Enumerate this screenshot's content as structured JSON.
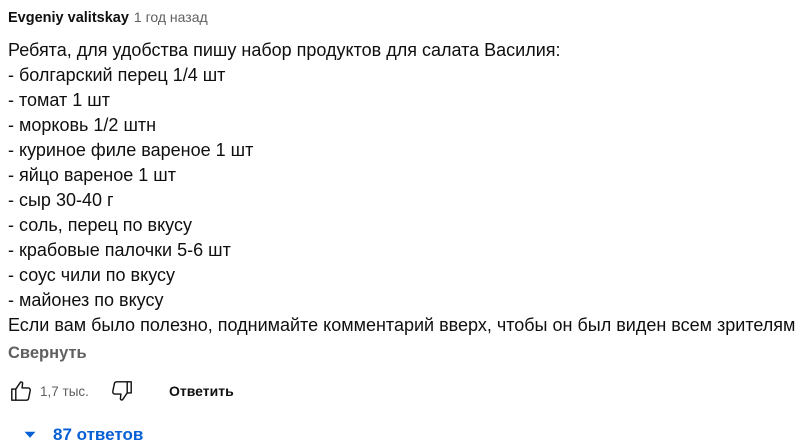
{
  "comment": {
    "author": "Evgeniy valitskay",
    "timestamp": "1 год назад",
    "lines": [
      "Ребята, для удобства пишу набор продуктов для салата Василия:",
      "- болгарский перец 1/4 шт",
      "- томат 1 шт",
      "- морковь 1/2 штн",
      "- куриное филе вареное 1 шт",
      "- яйцо вареное 1 шт",
      "- сыр 30-40 г",
      "- соль, перец по вкусу",
      "- крабовые палочки 5-6 шт",
      "- соус чили по вкусу",
      "- майонез по вкусу",
      "Если вам было полезно, поднимайте комментарий вверх, чтобы он был виден всем зрителям."
    ],
    "collapse_label": "Свернуть"
  },
  "actions": {
    "like_icon": "thumbs-up-icon",
    "like_count": "1,7 тыс.",
    "dislike_icon": "thumbs-down-icon",
    "reply_label": "Ответить"
  },
  "replies": {
    "icon": "chevron-down-icon",
    "label": "87 ответов"
  },
  "colors": {
    "text": "#0f0f0f",
    "secondary": "#606060",
    "link": "#065fd4",
    "background": "#ffffff"
  }
}
